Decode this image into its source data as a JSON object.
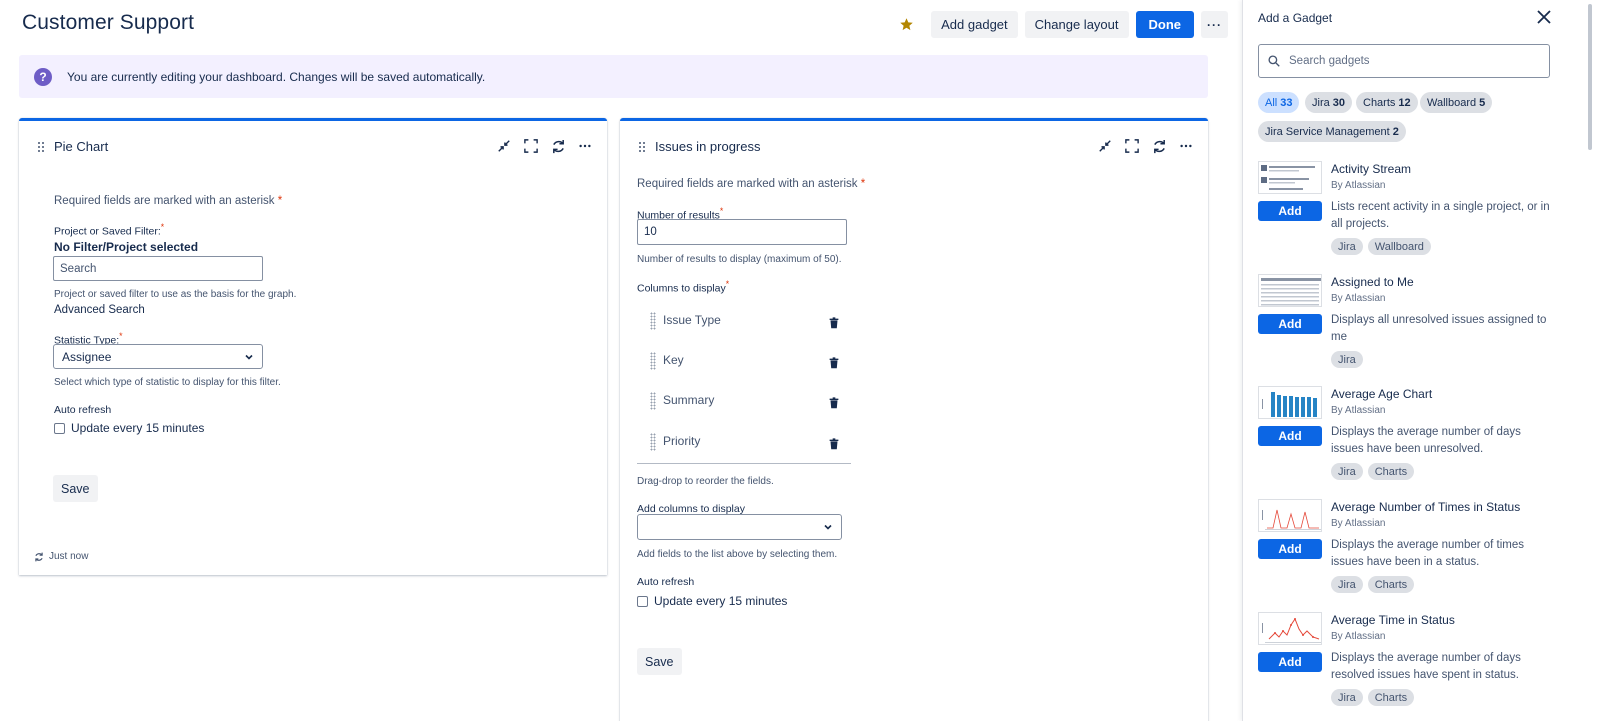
{
  "header": {
    "title": "Customer Support",
    "add_gadget": "Add gadget",
    "change_layout": "Change layout",
    "done": "Done",
    "more": "···"
  },
  "banner": {
    "text": "You are currently editing your dashboard. Changes will be saved automatically.",
    "icon": "?"
  },
  "pie_gadget": {
    "title": "Pie Chart",
    "required_note": "Required fields are marked with an asterisk",
    "asterisk": "*",
    "filter_label": "Project or Saved Filter:",
    "filter_value": "No Filter/Project selected",
    "search_placeholder": "Search",
    "filter_help": "Project or saved filter to use as the basis for the graph.",
    "advanced_search": "Advanced Search",
    "statistic_label": "Statistic Type:",
    "statistic_value": "Assignee",
    "statistic_help": "Select which type of statistic to display for this filter.",
    "auto_refresh_label": "Auto refresh",
    "auto_refresh_option": "Update every 15 minutes",
    "save": "Save",
    "refreshed": "Just now"
  },
  "issues_gadget": {
    "title": "Issues in progress",
    "required_note": "Required fields are marked with an asterisk",
    "asterisk": "*",
    "results_label": "Number of results",
    "results_value": "10",
    "results_help": "Number of results to display (maximum of 50).",
    "columns_label": "Columns to display",
    "columns": [
      "Issue Type",
      "Key",
      "Summary",
      "Priority"
    ],
    "columns_help": "Drag-drop to reorder the fields.",
    "add_columns_label": "Add columns to display",
    "add_columns_value": "",
    "add_columns_help": "Add fields to the list above by selecting them.",
    "auto_refresh_label": "Auto refresh",
    "auto_refresh_option": "Update every 15 minutes",
    "save": "Save"
  },
  "panel": {
    "title": "Add a Gadget",
    "search_placeholder": "Search gadgets",
    "chips": [
      {
        "label": "All",
        "count": "33",
        "active": true
      },
      {
        "label": "Jira",
        "count": "30"
      },
      {
        "label": "Charts",
        "count": "12"
      },
      {
        "label": "Wallboard",
        "count": "5"
      },
      {
        "label": "Jira Service Management",
        "count": "2"
      }
    ],
    "add_label": "Add",
    "gadgets": [
      {
        "name": "Activity Stream",
        "by": "By Atlassian",
        "desc": "Lists recent activity in a single project, or in all projects.",
        "tags": [
          "Jira",
          "Wallboard"
        ]
      },
      {
        "name": "Assigned to Me",
        "by": "By Atlassian",
        "desc": "Displays all unresolved issues assigned to me",
        "tags": [
          "Jira"
        ]
      },
      {
        "name": "Average Age Chart",
        "by": "By Atlassian",
        "desc": "Displays the average number of days issues have been unresolved.",
        "tags": [
          "Jira",
          "Charts"
        ]
      },
      {
        "name": "Average Number of Times in Status",
        "by": "By Atlassian",
        "desc": "Displays the average number of times issues have been in a status.",
        "tags": [
          "Jira",
          "Charts"
        ]
      },
      {
        "name": "Average Time in Status",
        "by": "By Atlassian",
        "desc": "Displays the average number of days resolved issues have spent in status.",
        "tags": [
          "Jira",
          "Charts"
        ]
      }
    ]
  },
  "icons": {
    "star": "star-icon",
    "close": "close-icon",
    "search": "search-icon",
    "minimize": "minimize-icon",
    "maximize": "maximize-icon",
    "refresh": "refresh-icon",
    "more": "more-icon",
    "trash": "trash-icon",
    "drag": "drag-handle-icon"
  },
  "colors": {
    "brand": "#0c66e4",
    "star": "#b38600",
    "banner_bg": "#f3f0ff",
    "banner_icon": "#6e5dc6",
    "required": "#de350b"
  }
}
